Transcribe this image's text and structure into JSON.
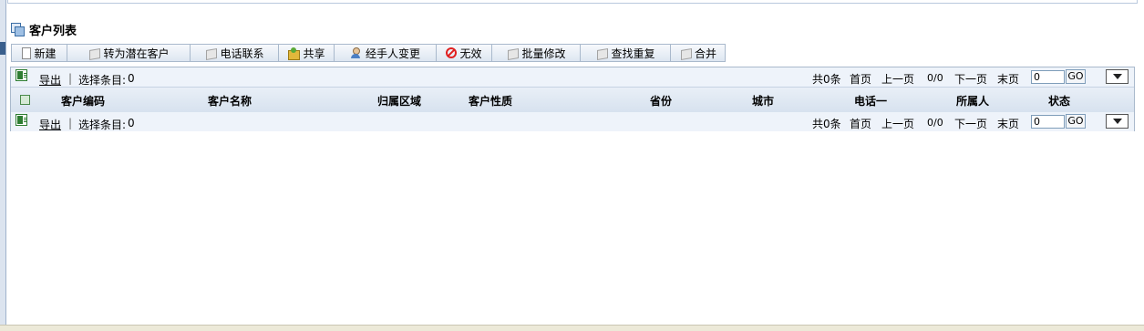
{
  "page": {
    "title": "客户列表"
  },
  "toolbar": [
    {
      "label": "新建",
      "icon": "new-document-icon"
    },
    {
      "label": "转为潜在客户",
      "icon": "cube-icon"
    },
    {
      "label": "电话联系",
      "icon": "cube-icon"
    },
    {
      "label": "共享",
      "icon": "share-icon"
    },
    {
      "label": "经手人变更",
      "icon": "user-icon"
    },
    {
      "label": "无效",
      "icon": "ban-icon"
    },
    {
      "label": "批量修改",
      "icon": "cube-icon"
    },
    {
      "label": "查找重复",
      "icon": "cube-icon"
    },
    {
      "label": "合并",
      "icon": "cube-icon"
    }
  ],
  "pager": {
    "export_label": "导出",
    "separator": "|",
    "select_label": "选择条目:",
    "select_count": "0",
    "total": "共0条",
    "first": "首页",
    "prev": "上一页",
    "pages": "0/0",
    "next": "下一页",
    "last": "末页",
    "page_input": "0",
    "go": "GO"
  },
  "table": {
    "columns": [
      "客户编码",
      "客户名称",
      "归属区域",
      "客户性质",
      "省份",
      "城市",
      "电话一",
      "所属人",
      "状态"
    ],
    "rows": []
  },
  "colors": {
    "header_bg": "#d7e2ef",
    "pager_bg": "#eef3fa",
    "border": "#a9b9cc"
  }
}
